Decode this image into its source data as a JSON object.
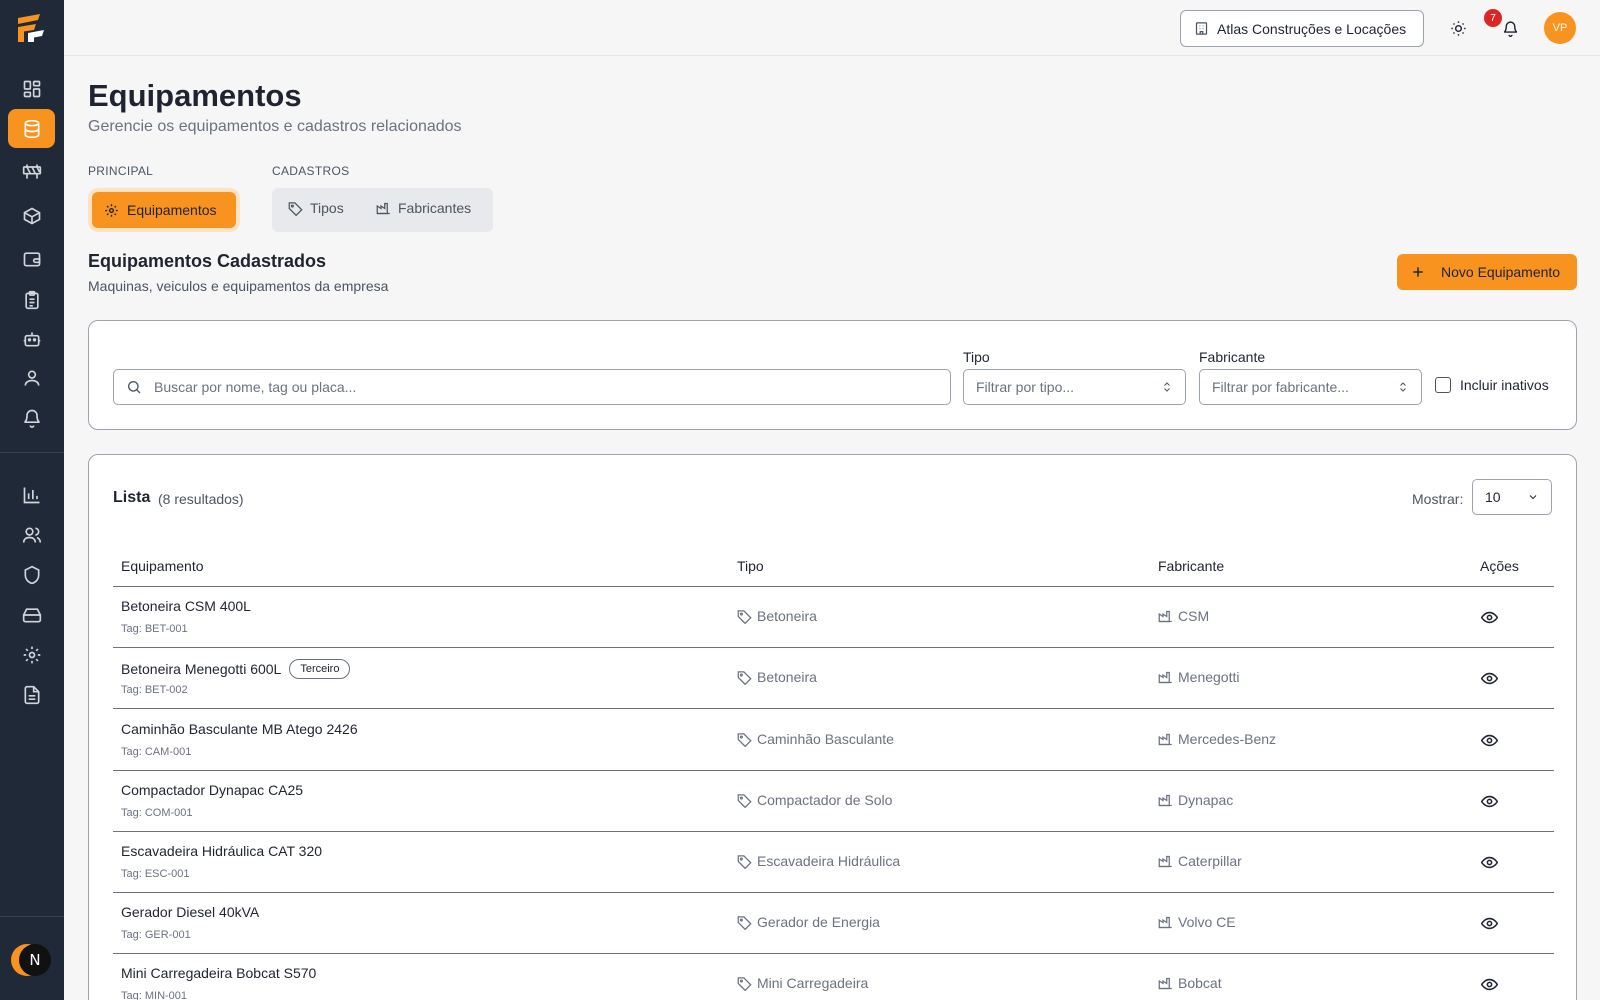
{
  "topbar": {
    "company": "Atlas Construções e Locações",
    "notification_count": "7",
    "avatar_initials": "VP"
  },
  "sidebar": {
    "user_initial": "N",
    "items": [
      {
        "icon": "dashboard-icon"
      },
      {
        "icon": "database-icon",
        "active": true
      },
      {
        "icon": "barrier-icon"
      },
      {
        "icon": "box-icon"
      },
      {
        "icon": "wallet-icon"
      },
      {
        "icon": "clipboard-icon"
      },
      {
        "icon": "robot-icon"
      },
      {
        "icon": "user-icon"
      },
      {
        "icon": "bell-icon"
      },
      {
        "icon": "chart-icon"
      },
      {
        "icon": "users-icon"
      },
      {
        "icon": "shield-icon"
      },
      {
        "icon": "hard-drive-icon"
      },
      {
        "icon": "gear-icon"
      },
      {
        "icon": "file-icon"
      }
    ]
  },
  "header": {
    "title": "Equipamentos",
    "subtitle": "Gerencie os equipamentos e cadastros relacionados"
  },
  "tabs": {
    "principal_label": "PRINCIPAL",
    "cadastros_label": "CADASTROS",
    "equipamentos": "Equipamentos",
    "tipos": "Tipos",
    "fabricantes": "Fabricantes"
  },
  "section": {
    "title": "Equipamentos Cadastrados",
    "subtitle": "Maquinas, veiculos e equipamentos da empresa",
    "new_button": "Novo Equipamento"
  },
  "filters": {
    "search_placeholder": "Buscar por nome, tag ou placa...",
    "type_label": "Tipo",
    "type_placeholder": "Filtrar por tipo...",
    "maker_label": "Fabricante",
    "maker_placeholder": "Filtrar por fabricante...",
    "include_inactive": "Incluir inativos"
  },
  "list": {
    "title": "Lista",
    "count": "(8 resultados)",
    "show_label": "Mostrar:",
    "show_value": "10",
    "columns": [
      "Equipamento",
      "Tipo",
      "Fabricante",
      "Ações"
    ],
    "rows": [
      {
        "name": "Betoneira CSM 400L",
        "tag": "Tag: BET-001",
        "type": "Betoneira",
        "maker": "CSM",
        "badge": ""
      },
      {
        "name": "Betoneira Menegotti 600L",
        "tag": "Tag: BET-002",
        "type": "Betoneira",
        "maker": "Menegotti",
        "badge": "Terceiro"
      },
      {
        "name": "Caminhão Basculante MB Atego 2426",
        "tag": "Tag: CAM-001",
        "type": "Caminhão Basculante",
        "maker": "Mercedes-Benz",
        "badge": ""
      },
      {
        "name": "Compactador Dynapac CA25",
        "tag": "Tag: COM-001",
        "type": "Compactador de Solo",
        "maker": "Dynapac",
        "badge": ""
      },
      {
        "name": "Escavadeira Hidráulica CAT 320",
        "tag": "Tag: ESC-001",
        "type": "Escavadeira Hidráulica",
        "maker": "Caterpillar",
        "badge": ""
      },
      {
        "name": "Gerador Diesel 40kVA",
        "tag": "Tag: GER-001",
        "type": "Gerador de Energia",
        "maker": "Volvo CE",
        "badge": ""
      },
      {
        "name": "Mini Carregadeira Bobcat S570",
        "tag": "Tag: MIN-001",
        "type": "Mini Carregadeira",
        "maker": "Bobcat",
        "badge": ""
      }
    ]
  }
}
